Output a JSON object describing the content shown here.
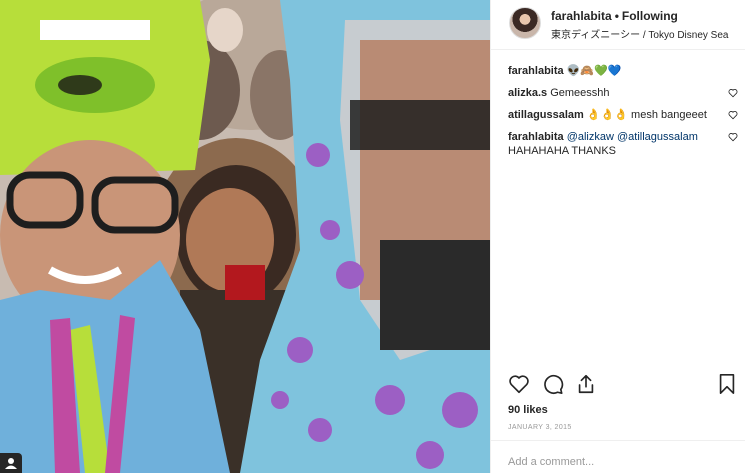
{
  "post": {
    "username": "farahlabita",
    "separator": "•",
    "follow_status": "Following",
    "location": "東京ディズニーシー / Tokyo Disney Sea",
    "likes": "90 likes",
    "date": "JANUARY 3, 2015",
    "add_comment_placeholder": "Add a comment..."
  },
  "comments": [
    {
      "user": "farahlabita",
      "text": "👽🙈💚💙",
      "has_like": false
    },
    {
      "user": "alizka.s",
      "text": "Gemeesshh",
      "has_like": true
    },
    {
      "user": "atillagussalam",
      "text": "👌👌👌 mesh bangeeet",
      "has_like": true
    },
    {
      "user": "farahlabita",
      "mentions": [
        "@alizkaw",
        "@atillagussalam"
      ],
      "text": "HAHAHAHA THANKS",
      "has_like": true
    }
  ],
  "icons": {
    "like": "heart-icon",
    "comment": "comment-bubble-icon",
    "share": "share-icon",
    "save": "bookmark-icon",
    "tag": "user-tag-icon"
  },
  "colors": {
    "text": "#262626",
    "muted": "#999999",
    "mention": "#003569",
    "border": "#efefef"
  }
}
